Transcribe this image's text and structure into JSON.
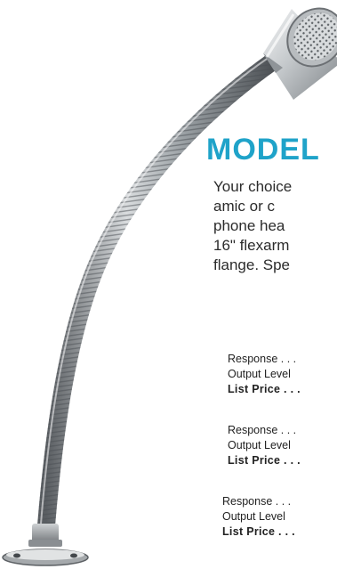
{
  "heading": "MODEL",
  "description_lines": [
    "Your choice",
    "amic  or  c",
    "phone  hea",
    "16\" flexarm",
    "flange. Spe"
  ],
  "specs": [
    {
      "response": "Response . . .",
      "output": "Output Level",
      "price": "List Price  . . ."
    },
    {
      "response": "Response . . .",
      "output": "Output Level",
      "price": "List Price  . . ."
    },
    {
      "response": "Response . . .",
      "output": "Output Level",
      "price": "List Price  . . ."
    }
  ],
  "colors": {
    "heading": "#1fa3c9",
    "text": "#2b2b2b",
    "background": "#ffffff"
  },
  "image": {
    "subject": "microphone-gooseneck-icon"
  }
}
